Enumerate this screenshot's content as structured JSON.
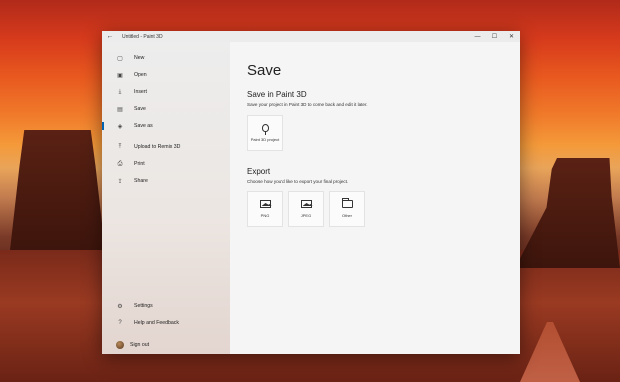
{
  "window": {
    "title": "Untitled - Paint 3D",
    "back_icon": "back-arrow-icon",
    "controls": {
      "minimize": "—",
      "maximize": "☐",
      "close": "✕"
    }
  },
  "sidebar": {
    "items": [
      {
        "id": "new",
        "label": "New",
        "icon": "new-file-icon",
        "glyph": "▢"
      },
      {
        "id": "open",
        "label": "Open",
        "icon": "open-icon",
        "glyph": "▣"
      },
      {
        "id": "insert",
        "label": "Insert",
        "icon": "insert-icon",
        "glyph": "⤓"
      },
      {
        "id": "save",
        "label": "Save",
        "icon": "save-icon",
        "glyph": "▤"
      },
      {
        "id": "save-as",
        "label": "Save as",
        "icon": "save-as-icon",
        "glyph": "◈",
        "active": true
      },
      {
        "id": "upload",
        "label": "Upload to Remix 3D",
        "icon": "upload-icon",
        "glyph": "⤒"
      },
      {
        "id": "print",
        "label": "Print",
        "icon": "print-icon",
        "glyph": "⎙"
      },
      {
        "id": "share",
        "label": "Share",
        "icon": "share-icon",
        "glyph": "⇪"
      }
    ],
    "bottom": [
      {
        "id": "settings",
        "label": "Settings",
        "icon": "gear-icon",
        "glyph": "⚙"
      },
      {
        "id": "help",
        "label": "Help and Feedback",
        "icon": "help-icon",
        "glyph": "?"
      }
    ],
    "account": {
      "label": "Sign out"
    }
  },
  "main": {
    "heading": "Save",
    "paint3d": {
      "title": "Save in Paint 3D",
      "description": "Save your project in Paint 3D to come back and edit it later.",
      "tile_label": "Paint 3D project"
    },
    "export": {
      "title": "Export",
      "description": "Choose how you'd like to export your final project.",
      "tiles": [
        {
          "id": "png",
          "label": "PNG",
          "icon": "image-icon"
        },
        {
          "id": "jpeg",
          "label": "JPEG",
          "icon": "image-icon"
        },
        {
          "id": "other",
          "label": "Other",
          "icon": "folder-icon"
        }
      ]
    }
  },
  "colors": {
    "accent": "#0063b1",
    "sidebar_bg": "#ededed",
    "main_bg": "#f5f5f5"
  }
}
